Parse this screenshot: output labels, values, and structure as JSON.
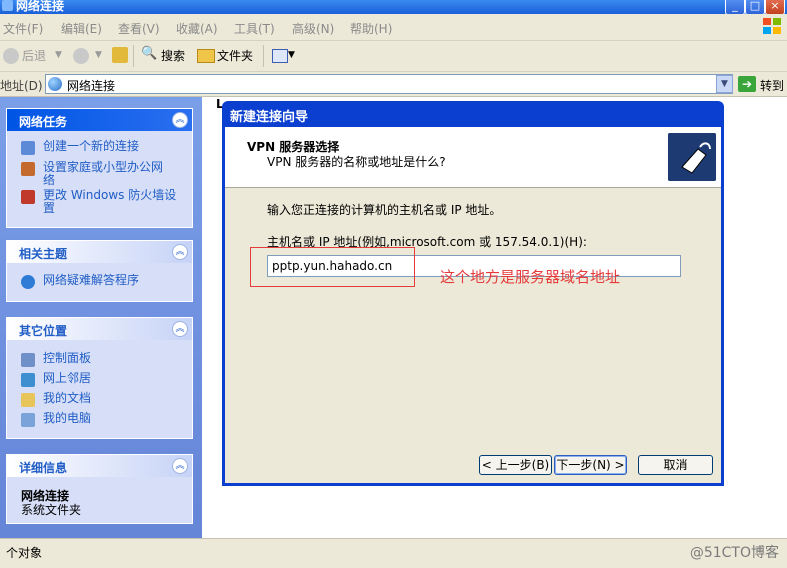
{
  "window": {
    "title": "网络连接"
  },
  "menu": [
    "文件(F)",
    "编辑(E)",
    "查看(V)",
    "收藏(A)",
    "工具(T)",
    "高级(N)",
    "帮助(H)"
  ],
  "toolbar": {
    "back": "后退",
    "search": "搜索",
    "folders": "文件夹"
  },
  "address": {
    "label": "地址(D)",
    "value": "网络连接",
    "go": "转到"
  },
  "sidebar": {
    "tasks": {
      "title": "网络任务",
      "items": [
        "创建一个新的连接",
        "设置家庭或小型办公网络",
        "更改 Windows 防火墙设置"
      ]
    },
    "related": {
      "title": "相关主题",
      "items": [
        "网络疑难解答程序"
      ]
    },
    "places": {
      "title": "其它位置",
      "items": [
        "控制面板",
        "网上邻居",
        "我的文档",
        "我的电脑"
      ]
    },
    "details": {
      "title": "详细信息",
      "name": "网络连接",
      "type": "系统文件夹"
    }
  },
  "content": {
    "header_fragment": "L"
  },
  "dialog": {
    "title": "新建连接向导",
    "heading": "VPN 服务器选择",
    "subheading": "VPN 服务器的名称或地址是什么?",
    "prompt": "输入您正连接的计算机的主机名或 IP 地址。",
    "host_label": "主机名或 IP 地址(例如,microsoft.com 或 157.54.0.1)(H):",
    "host_value": "pptp.yun.hahado.cn",
    "back_button": "< 上一步(B)",
    "next_button": "下一步(N) >",
    "cancel_button": "取消"
  },
  "annotation": "这个地方是服务器域名地址",
  "status": {
    "text": "个对象",
    "watermark": "@51CTO博客"
  }
}
